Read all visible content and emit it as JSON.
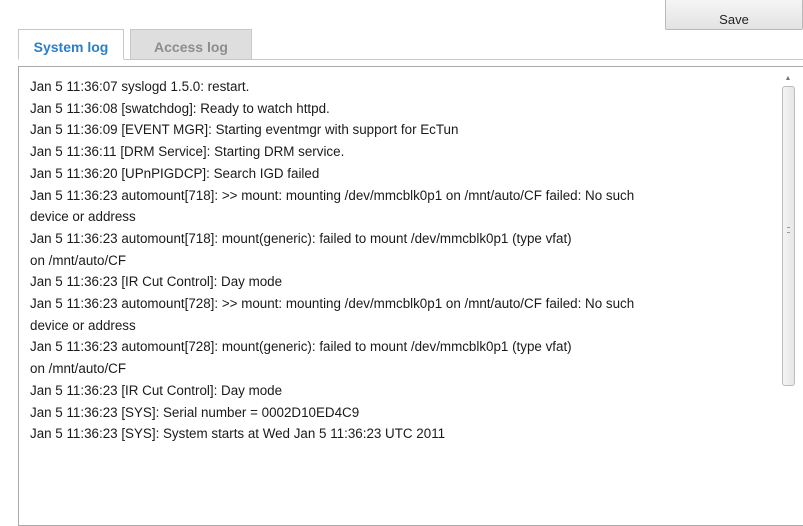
{
  "toolbar": {
    "save_label": "Save"
  },
  "tabs": [
    {
      "label": "System log",
      "active": true
    },
    {
      "label": "Access log",
      "active": false
    }
  ],
  "colors": {
    "active_tab": "#2a7fca",
    "inactive_tab_bg": "#dedede",
    "inactive_tab_text": "#8d8d8d"
  },
  "log": {
    "lines": [
      "Jan 5 11:36:07 syslogd 1.5.0: restart.",
      "Jan 5 11:36:08 [swatchdog]: Ready to watch httpd.",
      "Jan 5 11:36:09 [EVENT MGR]: Starting eventmgr with support for EcTun",
      "Jan 5 11:36:11 [DRM Service]: Starting DRM service.",
      "Jan 5 11:36:20 [UPnPIGDCP]: Search IGD failed",
      "Jan 5 11:36:23 automount[718]: >> mount: mounting /dev/mmcblk0p1 on /mnt/auto/CF failed: No such",
      "device or address",
      "Jan 5 11:36:23 automount[718]: mount(generic): failed to mount /dev/mmcblk0p1 (type vfat)",
      "on /mnt/auto/CF",
      "Jan 5 11:36:23 [IR Cut Control]: Day mode",
      "Jan 5 11:36:23 automount[728]: >> mount: mounting /dev/mmcblk0p1 on /mnt/auto/CF failed: No such",
      "device or address",
      "Jan 5 11:36:23 automount[728]: mount(generic): failed to mount /dev/mmcblk0p1 (type vfat)",
      "on /mnt/auto/CF",
      "Jan 5 11:36:23 [IR Cut Control]: Day mode",
      "Jan 5 11:36:23 [SYS]: Serial number = 0002D10ED4C9",
      "Jan 5 11:36:23 [SYS]: System starts at Wed Jan 5 11:36:23 UTC 2011"
    ]
  }
}
